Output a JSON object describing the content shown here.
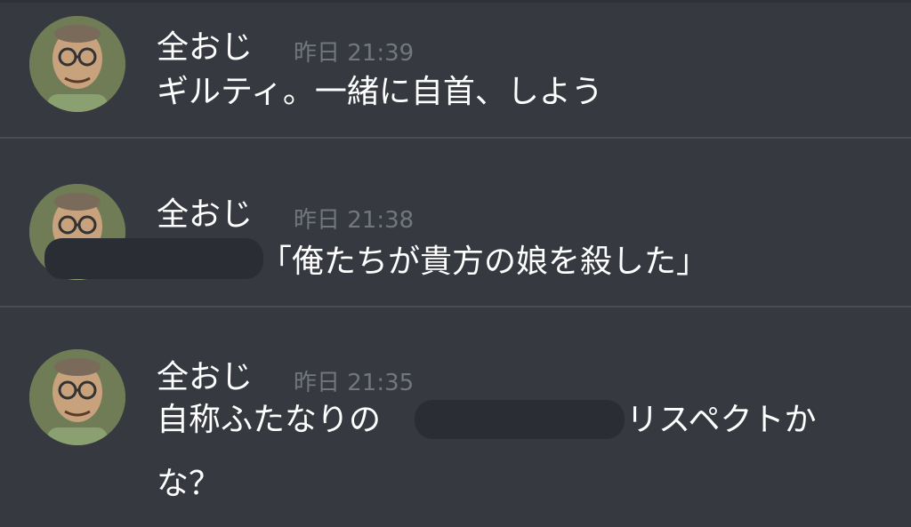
{
  "messages": [
    {
      "author": "全おじ",
      "timestamp": "昨日 21:39",
      "avatar_icon": "user-avatar-icon",
      "text": "ギルティ。一緒に自首、しよう"
    },
    {
      "author": "全おじ",
      "timestamp": "昨日 21:38",
      "avatar_icon": "user-avatar-icon",
      "text_before": "",
      "text_after": "「俺たちが貴方の娘を殺した」"
    },
    {
      "author": "全おじ",
      "timestamp": "昨日 21:35",
      "avatar_icon": "user-avatar-icon",
      "text_line1_before": "自称ふたなりの",
      "text_line1_after": "リスペクトか",
      "text_line2": "な？"
    }
  ],
  "colors": {
    "background": "#36393f",
    "divider": "#4a4d53",
    "username": "#ffffff",
    "timestamp": "#72767d",
    "message_text": "#ffffff",
    "redaction": "#2a2d33"
  }
}
